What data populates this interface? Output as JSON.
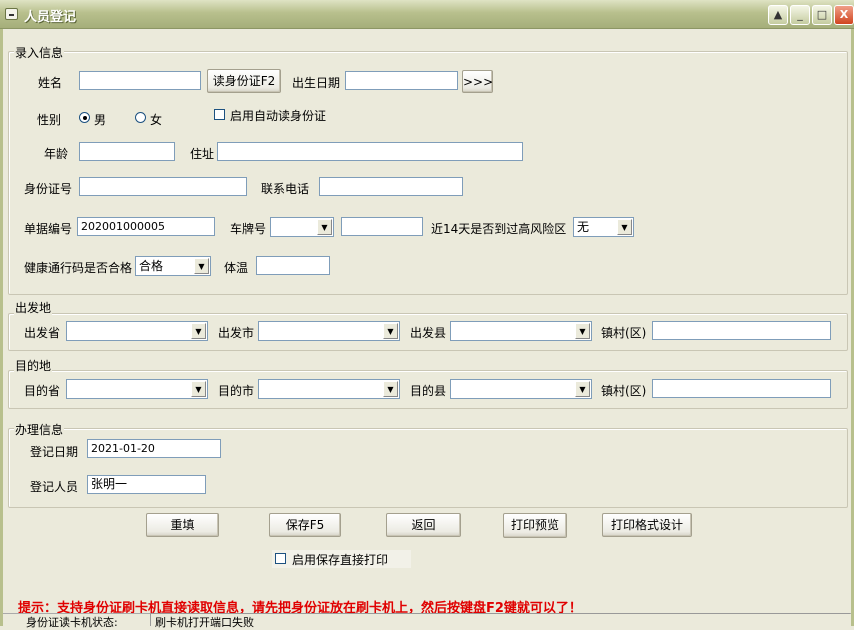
{
  "window": {
    "title": "人员登记"
  },
  "entry": {
    "group": "录入信息",
    "name_label": "姓名",
    "name_value": "",
    "read_id_button": "读身份证F2",
    "birth_label": "出生日期",
    "birth_value": "",
    "date_picker_button": ">>>",
    "gender_label": "性别",
    "gender_male": "男",
    "gender_female": "女",
    "auto_read_label": "启用自动读身份证",
    "age_label": "年龄",
    "address_label": "住址",
    "id_label": "身份证号",
    "phone_label": "联系电话",
    "doc_no_label": "单据编号",
    "doc_no_value": "202001000005",
    "plate_label": "车牌号",
    "risk_label": "近14天是否到过高风险区",
    "risk_value": "无",
    "health_label": "健康通行码是否合格",
    "health_value": "合格",
    "temp_label": "体温"
  },
  "departure": {
    "group": "出发地",
    "province": "出发省",
    "city": "出发市",
    "county": "出发县",
    "town": "镇村(区)"
  },
  "destination": {
    "group": "目的地",
    "province": "目的省",
    "city": "目的市",
    "county": "目的县",
    "town": "镇村(区)"
  },
  "handling": {
    "group": "办理信息",
    "date_label": "登记日期",
    "date_value": "2021-01-20",
    "person_label": "登记人员",
    "person_value": "张明一"
  },
  "buttons": {
    "reset": "重填",
    "save": "保存F5",
    "back": "返回",
    "preview": "打印预览",
    "design": "打印格式设计"
  },
  "print_on_save_label": "启用保存直接打印",
  "hint": "提示：支持身份证刷卡机直接读取信息，请先把身份证放在刷卡机上，然后按键盘F2键就可以了！",
  "status": {
    "label": "身份证读卡机状态:",
    "value": "刷卡机打开端口失败"
  }
}
